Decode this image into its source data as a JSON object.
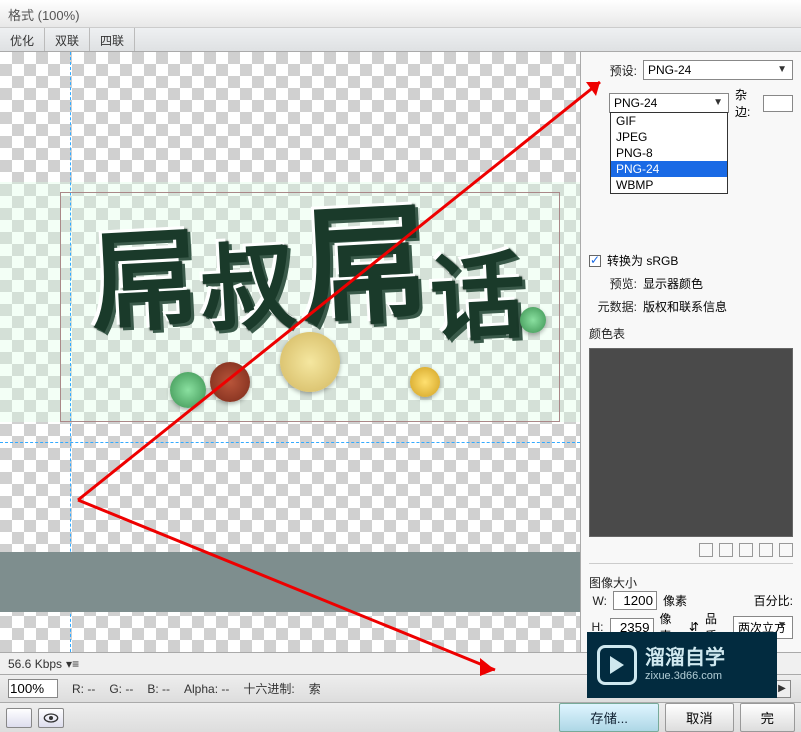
{
  "title": "格式 (100%)",
  "tabs": {
    "t1": "优化",
    "t2": "双联",
    "t3": "四联"
  },
  "preset_label": "预设:",
  "preset_value": "PNG-24",
  "format_value": "PNG-24",
  "format_options": [
    "GIF",
    "JPEG",
    "PNG-8",
    "PNG-24",
    "WBMP"
  ],
  "matte_label": "杂边:",
  "convert_srgb": "转换为 sRGB",
  "preview_label": "预览:",
  "preview_value": "显示器颜色",
  "metadata_label": "元数据:",
  "metadata_value": "版权和联系信息",
  "colortable_label": "颜色表",
  "imagesize_label": "图像大小",
  "w_label": "W:",
  "h_label": "H:",
  "w_value": "1200",
  "h_value": "2359",
  "px_label": "像素",
  "percent_label": "百分比:",
  "quality_label": "品质:",
  "quality_value": "两次立方",
  "status1": "56.6 Kbps",
  "zoom": "100%",
  "r": "R:  --",
  "g": "G:  --",
  "b": "B:  --",
  "alpha": "Alpha:  --",
  "hex_label": "十六进制:",
  "index_label": "索",
  "save_btn": "存储...",
  "cancel_btn": "取消",
  "done_btn": "完",
  "wm_title": "溜溜自学",
  "wm_sub": "zixue.3d66.com",
  "art": {
    "c1": "屌",
    "c2": "叔",
    "c3": "屌",
    "c4": "话"
  }
}
